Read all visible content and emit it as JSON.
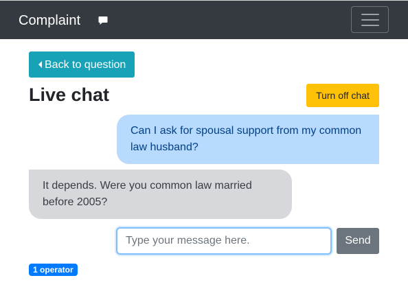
{
  "navbar": {
    "brand": "Complaint",
    "brand_icon": "comment-icon",
    "toggler_icon": "hamburger-menu-icon"
  },
  "back_button": {
    "label": "Back to question",
    "icon": "caret-left-icon"
  },
  "page_title": "Live chat",
  "turn_off_button": {
    "label": "Turn off chat"
  },
  "messages": [
    {
      "sender": "user",
      "text": "Can I ask for spousal support from my common law husband?"
    },
    {
      "sender": "operator",
      "text": "It depends. Were you common law married before 2005?"
    }
  ],
  "message_input": {
    "placeholder": "Type your message here.",
    "value": ""
  },
  "send_button": {
    "label": "Send"
  },
  "operator_badge": {
    "label": "1 operator"
  },
  "colors": {
    "navbar_bg": "#343a40",
    "back_button_bg": "#17a2b8",
    "turn_off_bg": "#ffc107",
    "user_bubble_bg": "#b8daff",
    "user_bubble_text": "#004085",
    "operator_bubble_bg": "#d6d8db",
    "operator_bubble_text": "#383d41",
    "send_button_bg": "#6c757d",
    "badge_bg": "#007bff"
  }
}
